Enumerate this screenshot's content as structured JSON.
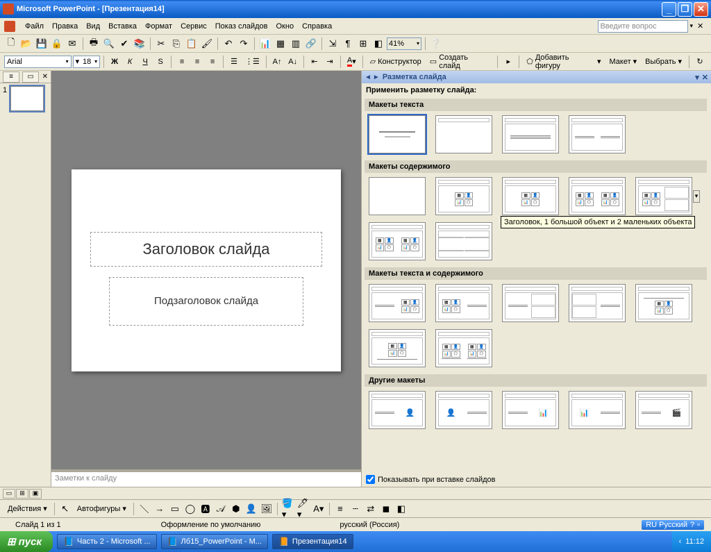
{
  "titlebar": {
    "text": "Microsoft PowerPoint - [Презентация14]"
  },
  "menu": {
    "file": "Файл",
    "edit": "Правка",
    "view": "Вид",
    "insert": "Вставка",
    "format": "Формат",
    "tools": "Сервис",
    "slideshow": "Показ слайдов",
    "window": "Окно",
    "help": "Справка",
    "help_placeholder": "Введите вопрос"
  },
  "toolbar": {
    "zoom": "41%"
  },
  "format": {
    "font": "Arial",
    "size": "18",
    "bold": "Ж",
    "italic": "К",
    "underline": "Ч",
    "shadow": "S",
    "designer": "Конструктор",
    "newslide": "Создать слайд",
    "addshape": "Добавить фигуру",
    "layout": "Макет",
    "select": "Выбрать"
  },
  "thumbs": {
    "num1": "1"
  },
  "slide": {
    "title": "Заголовок слайда",
    "subtitle": "Подзаголовок слайда"
  },
  "notes": {
    "placeholder": "Заметки к слайду"
  },
  "pane": {
    "title": "Разметка слайда",
    "apply": "Применить разметку слайда:",
    "sec_text": "Макеты текста",
    "sec_content": "Макеты содержимого",
    "sec_textcontent": "Макеты текста и содержимого",
    "sec_other": "Другие макеты",
    "tooltip": "Заголовок, 1 большой объект и 2 маленьких объекта",
    "footer": "Показывать при вставке слайдов"
  },
  "draw": {
    "actions": "Действия",
    "autoshapes": "Автофигуры"
  },
  "status": {
    "slide": "Слайд 1 из 1",
    "design": "Оформление по умолчанию",
    "lang": "русский (Россия)",
    "input_lang": "RU Русский"
  },
  "taskbar": {
    "start": "пуск",
    "t1": "Часть 2 - Microsoft ...",
    "t2": "Лб15_PowerPoint - M...",
    "t3": "Презентация14",
    "time": "11:12"
  }
}
